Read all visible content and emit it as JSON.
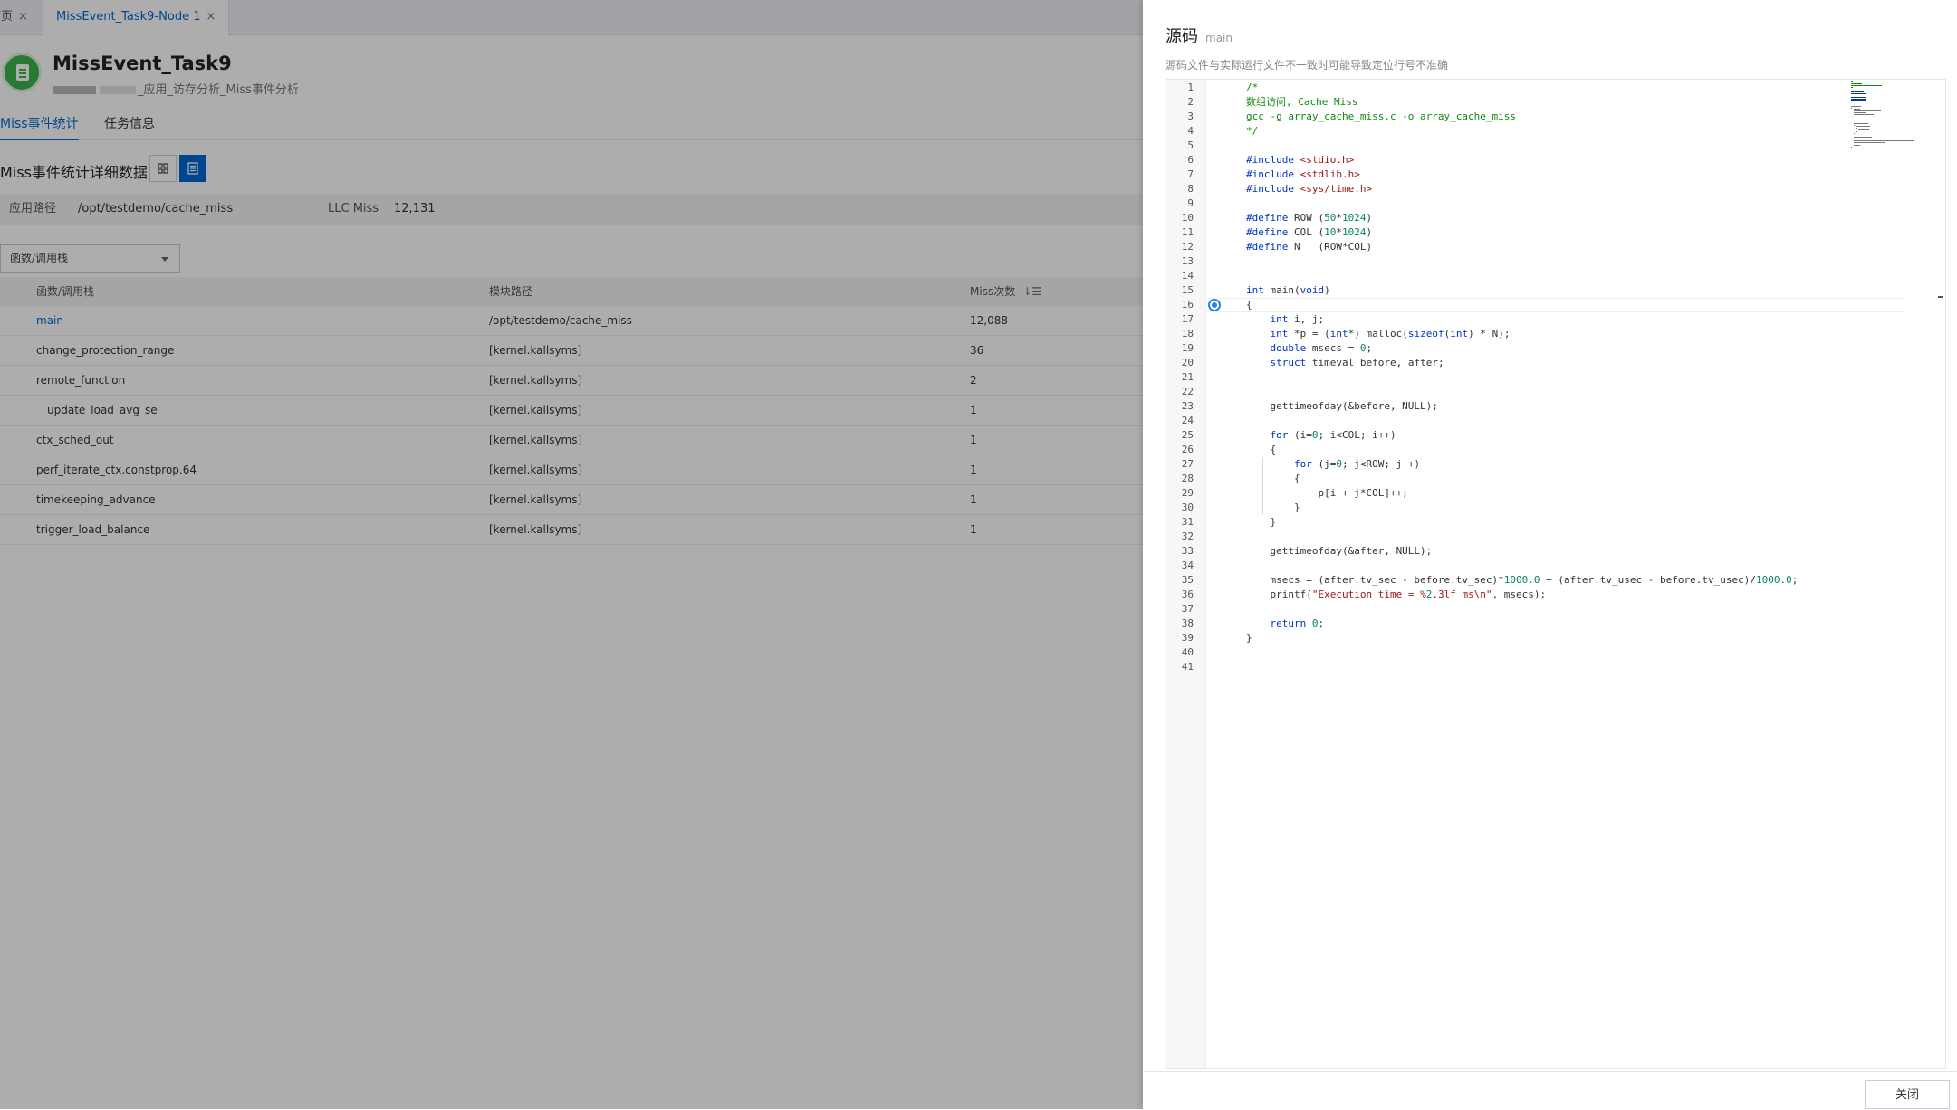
{
  "tabs": [
    {
      "label": "首页",
      "close": "×"
    },
    {
      "label": "MissEvent_Task9-Node 1",
      "close": "×"
    }
  ],
  "task": {
    "title": "MissEvent_Task9",
    "subtitle": "_应用_访存分析_Miss事件分析",
    "icon": "clipboard-icon",
    "icon_color": "#3bb34a"
  },
  "subtabs": [
    "Miss事件统计",
    "任务信息"
  ],
  "detail": {
    "title": "Miss事件统计详细数据",
    "view_buttons": [
      "grid-view-icon",
      "list-view-icon"
    ]
  },
  "info": {
    "app_path_label": "应用路径",
    "app_path_value": "/opt/testdemo/cache_miss",
    "llc_label": "LLC Miss",
    "llc_value": "12,131"
  },
  "filter": {
    "selected": "函数/调用栈"
  },
  "table": {
    "headers": [
      "函数/调用栈",
      "模块路径",
      "Miss次数"
    ],
    "rows": [
      [
        "main",
        "/opt/testdemo/cache_miss",
        "12,088"
      ],
      [
        "change_protection_range",
        "[kernel.kallsyms]",
        "36"
      ],
      [
        "remote_function",
        "[kernel.kallsyms]",
        "2"
      ],
      [
        "__update_load_avg_se",
        "[kernel.kallsyms]",
        "1"
      ],
      [
        "ctx_sched_out",
        "[kernel.kallsyms]",
        "1"
      ],
      [
        "perf_iterate_ctx.constprop.64",
        "[kernel.kallsyms]",
        "1"
      ],
      [
        "timekeeping_advance",
        "[kernel.kallsyms]",
        "1"
      ],
      [
        "trigger_load_balance",
        "[kernel.kallsyms]",
        "1"
      ]
    ]
  },
  "drawer": {
    "title": "源码",
    "function": "main",
    "hint": "源码文件与实际运行文件不一致时可能导致定位行号不准确",
    "close_label": "关闭",
    "highlight_line": 16,
    "code_lines": [
      "/*",
      "数组访问, Cache Miss",
      "gcc -g array_cache_miss.c -o array_cache_miss",
      "*/",
      "",
      "#include <stdio.h>",
      "#include <stdlib.h>",
      "#include <sys/time.h>",
      "",
      "#define ROW (50*1024)",
      "#define COL (10*1024)",
      "#define N   (ROW*COL)",
      "",
      "",
      "int main(void)",
      "{",
      "    int i, j;",
      "    int *p = (int*) malloc(sizeof(int) * N);",
      "    double msecs = 0;",
      "    struct timeval before, after;",
      "",
      "",
      "    gettimeofday(&before, NULL);",
      "",
      "    for (i=0; i<COL; i++)",
      "    {",
      "        for (j=0; j<ROW; j++)",
      "        {",
      "            p[i + j*COL]++;",
      "        }",
      "    }",
      "",
      "    gettimeofday(&after, NULL);",
      "",
      "    msecs = (after.tv_sec - before.tv_sec)*1000.0 + (after.tv_usec - before.tv_usec)/1000.0;",
      "    printf(\"Execution time = %2.3lf ms\\n\", msecs);",
      "",
      "    return 0;",
      "}",
      "",
      ""
    ]
  },
  "colors": {
    "accent": "#0067d1",
    "comment": "#108a10",
    "keyword": "#0033c4",
    "string": "#a31515",
    "number": "#098658"
  }
}
